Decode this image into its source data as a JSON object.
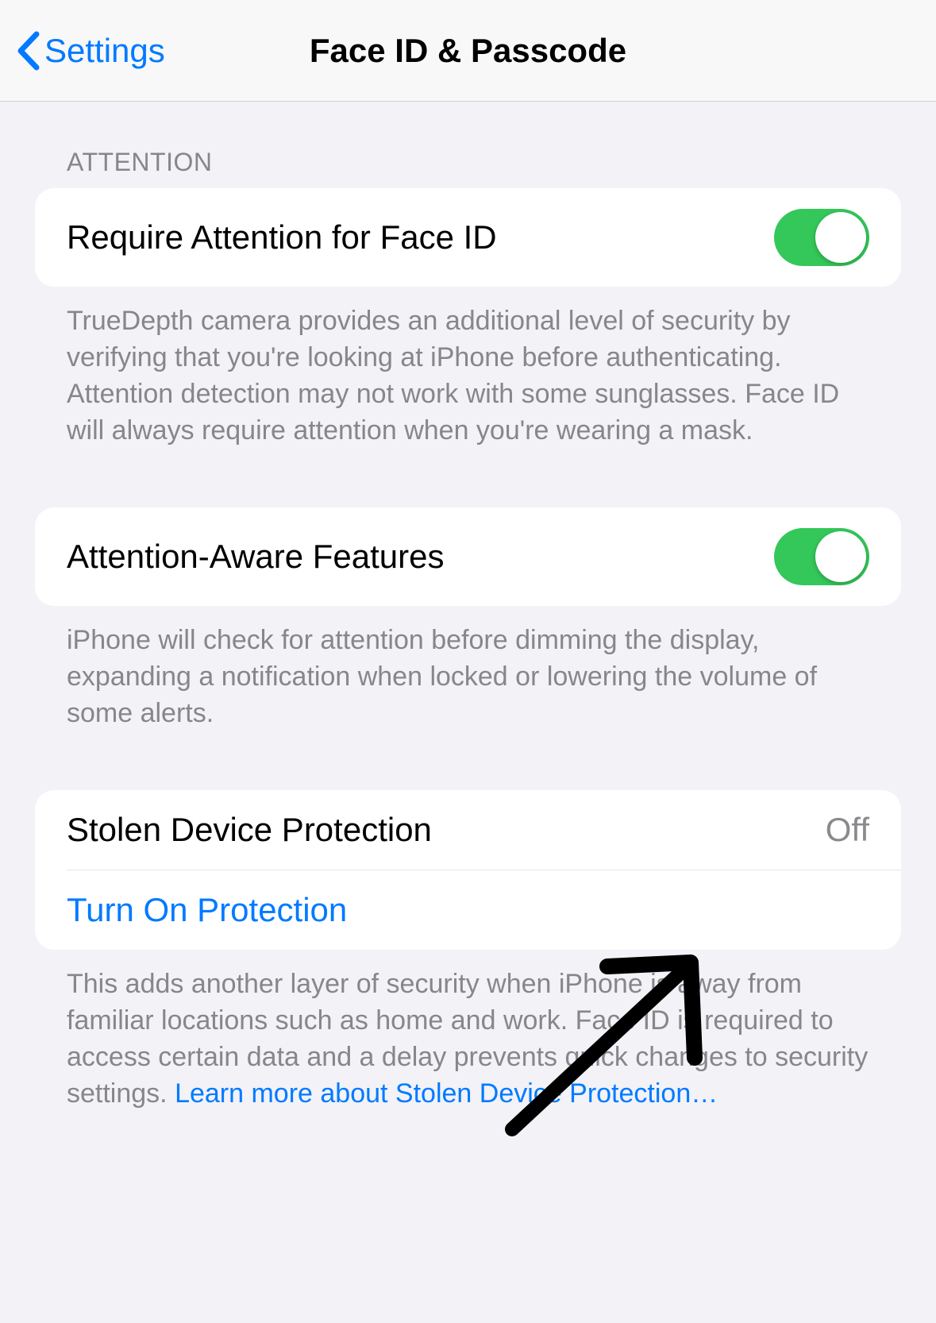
{
  "nav": {
    "back_label": "Settings",
    "title": "Face ID & Passcode"
  },
  "sections": {
    "attention_header": "ATTENTION",
    "require_attention": {
      "label": "Require Attention for Face ID",
      "enabled": true,
      "footer": "TrueDepth camera provides an additional level of security by verifying that you're looking at iPhone before authenticating. Attention detection may not work with some sunglasses. Face ID will always require attention when you're wearing a mask."
    },
    "attention_aware": {
      "label": "Attention-Aware Features",
      "enabled": true,
      "footer": "iPhone will check for attention before dimming the display, expanding a notification when locked or lowering the volume of some alerts."
    },
    "stolen_device": {
      "label": "Stolen Device Protection",
      "status": "Off",
      "action_label": "Turn On Protection",
      "footer": "This adds another layer of security when iPhone is away from familiar locations such as home and work. Face ID is required to access certain data and a delay prevents quick changes to security settings. ",
      "learn_more": "Learn more about Stolen Device Protection…"
    }
  },
  "colors": {
    "accent": "#007aff",
    "toggle_on": "#34c759",
    "background": "#f2f2f7",
    "secondary_text": "#86868b"
  }
}
